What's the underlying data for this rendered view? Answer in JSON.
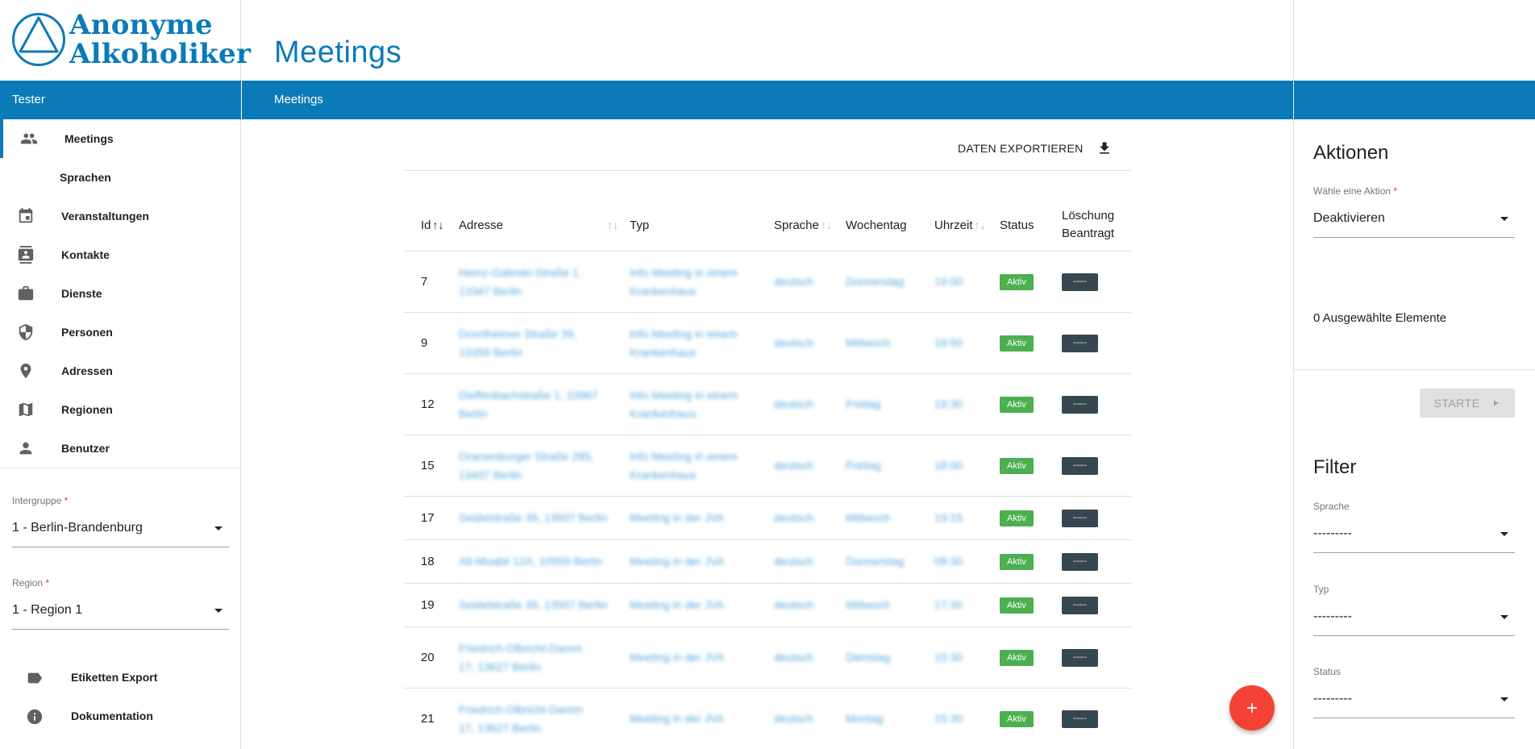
{
  "logo": {
    "line1": "Anonyme",
    "line2": "Alkoholiker"
  },
  "sidebar": {
    "user": "Tester",
    "nav": [
      {
        "label": "Meetings",
        "icon": "people-icon"
      },
      {
        "label": "Sprachen",
        "icon": ""
      },
      {
        "label": "Veranstaltungen",
        "icon": "calendar-icon"
      },
      {
        "label": "Kontakte",
        "icon": "contacts-icon"
      },
      {
        "label": "Dienste",
        "icon": "briefcase-icon"
      },
      {
        "label": "Personen",
        "icon": "shield-icon"
      },
      {
        "label": "Adressen",
        "icon": "location-pin-icon"
      },
      {
        "label": "Regionen",
        "icon": "map-icon"
      },
      {
        "label": "Benutzer",
        "icon": "person-icon"
      }
    ],
    "intergruppe": {
      "label": "Intergruppe",
      "value": "1 - Berlin-Brandenburg"
    },
    "region": {
      "label": "Region",
      "value": "1 - Region 1"
    },
    "extras": [
      {
        "label": "Etiketten Export",
        "icon": "label-icon"
      },
      {
        "label": "Dokumentation",
        "icon": "info-icon"
      }
    ],
    "required_mark": "*"
  },
  "page": {
    "title": "Meetings",
    "bar_title": "Meetings"
  },
  "toolbar": {
    "export_label": "DATEN EXPORTIEREN"
  },
  "table": {
    "headers": {
      "id": "Id",
      "adresse": "Adresse",
      "typ": "Typ",
      "sprache": "Sprache",
      "wochentag": "Wochentag",
      "uhrzeit": "Uhrzeit",
      "status": "Status",
      "loeschung1": "Löschung",
      "loeschung2": "Beantragt"
    },
    "sort_icons": {
      "active": "↑↓",
      "inactive": "↑↓"
    },
    "rows": [
      {
        "id": "7",
        "adresse": "Heinz-Galinski-Straße 1, 13347 Berlin",
        "typ": "Info Meeting in einem Krankenhaus",
        "sprache": "deutsch",
        "wochentag": "Donnerstag",
        "uhrzeit": "19:00",
        "status": "Aktiv",
        "loeschung": "-----"
      },
      {
        "id": "9",
        "adresse": "Drontheimer Straße 39, 13359 Berlin",
        "typ": "Info Meeting in einem Krankenhaus",
        "sprache": "deutsch",
        "wochentag": "Mittwoch",
        "uhrzeit": "18:50",
        "status": "Aktiv",
        "loeschung": "-----"
      },
      {
        "id": "12",
        "adresse": "Dieffenbachstraße 1, 10967 Berlin",
        "typ": "Info Meeting in einem Krankenhaus",
        "sprache": "deutsch",
        "wochentag": "Freitag",
        "uhrzeit": "19:30",
        "status": "Aktiv",
        "loeschung": "-----"
      },
      {
        "id": "15",
        "adresse": "Oranienburger Straße 285, 13437 Berlin",
        "typ": "Info Meeting in einem Krankenhaus",
        "sprache": "deutsch",
        "wochentag": "Freitag",
        "uhrzeit": "18:00",
        "status": "Aktiv",
        "loeschung": "-----"
      },
      {
        "id": "17",
        "adresse": "Seidelstraße 39, 13507 Berlin",
        "typ": "Meeting in der JVA",
        "sprache": "deutsch",
        "wochentag": "Mittwoch",
        "uhrzeit": "19:15",
        "status": "Aktiv",
        "loeschung": "-----"
      },
      {
        "id": "18",
        "adresse": "Alt-Moabit 12A, 10559 Berlin",
        "typ": "Meeting in der JVA",
        "sprache": "deutsch",
        "wochentag": "Donnerstag",
        "uhrzeit": "08:30",
        "status": "Aktiv",
        "loeschung": "-----"
      },
      {
        "id": "19",
        "adresse": "Seidelstraße 39, 13507 Berlin",
        "typ": "Meeting in der JVA",
        "sprache": "deutsch",
        "wochentag": "Mittwoch",
        "uhrzeit": "17:30",
        "status": "Aktiv",
        "loeschung": "-----"
      },
      {
        "id": "20",
        "adresse": "Friedrich-Olbricht-Damm 17, 13627 Berlin",
        "typ": "Meeting in der JVA",
        "sprache": "deutsch",
        "wochentag": "Dienstag",
        "uhrzeit": "15:30",
        "status": "Aktiv",
        "loeschung": "-----"
      },
      {
        "id": "21",
        "adresse": "Friedrich-Olbricht-Damm 17, 13627 Berlin",
        "typ": "Meeting in der JVA",
        "sprache": "deutsch",
        "wochentag": "Montag",
        "uhrzeit": "15:30",
        "status": "Aktiv",
        "loeschung": "-----"
      }
    ]
  },
  "right_panel": {
    "actions_heading": "Aktionen",
    "action_select": {
      "label": "Wähle eine Aktion",
      "value": "Deaktivieren"
    },
    "selected_count": "0 Ausgewählte Elemente",
    "start_label": "STARTE",
    "filter_heading": "Filter",
    "filters": [
      {
        "label": "Sprache",
        "value": "---------"
      },
      {
        "label": "Typ",
        "value": "---------"
      },
      {
        "label": "Status",
        "value": "---------"
      }
    ]
  },
  "colors": {
    "primary": "#0b7bb7",
    "aktiv": "#4caf50",
    "fab": "#f44336",
    "del_badge": "#37474f"
  }
}
